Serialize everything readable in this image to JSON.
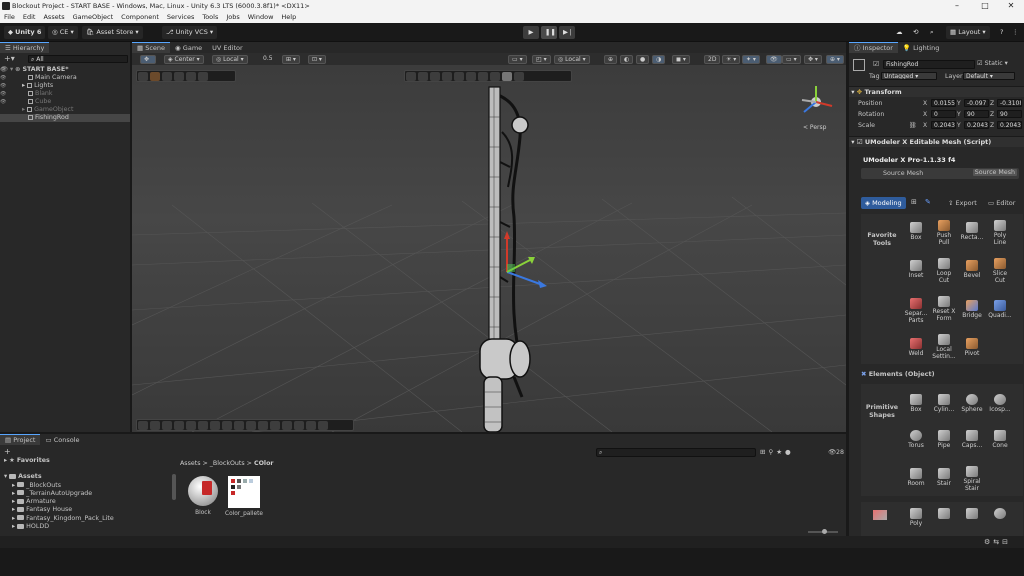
{
  "window": {
    "title": "Blockout Project - START BASE - Windows, Mac, Linux - Unity 6.3 LTS (6000.3.8f1)* <DX11>",
    "minimize": "–",
    "maximize": "□",
    "close": "✕"
  },
  "menu": [
    "File",
    "Edit",
    "Assets",
    "GameObject",
    "Component",
    "Services",
    "Tools",
    "Jobs",
    "Window",
    "Help"
  ],
  "toolbar": {
    "account": "Unity 6",
    "ce": "CE",
    "asset_store": "Asset Store",
    "vcs": "Unity VCS",
    "layout": "Layout"
  },
  "hierarchy": {
    "tab": "Hierarchy",
    "search": "All",
    "scene": "START BASE*",
    "items": [
      "Main Camera",
      "Lights",
      "Blank",
      "Cube",
      "GameObject",
      "FishingRod"
    ]
  },
  "scene_view": {
    "tabs": [
      "Scene",
      "Game",
      "UV Editor"
    ],
    "pivot": "Center",
    "space": "Local",
    "snap": "0.5",
    "handle_space": "Local",
    "persp": "< Persp"
  },
  "inspector": {
    "tabs": [
      "Inspector",
      "Lighting"
    ],
    "object_name": "FishingRod",
    "static": "Static",
    "tag_label": "Tag",
    "tag": "Untagged",
    "layer_label": "Layer",
    "layer": "Default",
    "transform": {
      "title": "Transform",
      "position": {
        "label": "Position",
        "x": "0.0155",
        "y": "-0.097",
        "z": "-0.3108"
      },
      "rotation": {
        "label": "Rotation",
        "x": "0",
        "y": "90",
        "z": "90"
      },
      "scale": {
        "label": "Scale",
        "x": "0.2043",
        "y": "0.2043",
        "z": "0.2043"
      }
    },
    "component": "UModeler X Editable Mesh (Script)",
    "umodeler_version": "UModeler X Pro-1.1.33 f4",
    "source_mesh": "Source Mesh",
    "source_mesh_btn": "Source Mesh",
    "modes": {
      "modeling": "Modeling",
      "export": "Export",
      "editor": "Editor"
    },
    "favorite_label": "Favorite Tools",
    "tools": [
      "Box",
      "Push Pull",
      "Recta...",
      "Poly Line",
      "Inset",
      "Loop Cut",
      "Bevel",
      "Slice Cut",
      "Separ... Parts",
      "Reset X Form",
      "Bridge",
      "Quadi...",
      "Weld",
      "Local Settin...",
      "Pivot"
    ],
    "elements_title": "Elements (Object)",
    "primitive_label": "Primitive Shapes",
    "primitives": [
      "Box",
      "Cylin...",
      "Sphere",
      "Icosp...",
      "Torus",
      "Pipe",
      "Caps...",
      "Cone",
      "Room",
      "Stair",
      "Spiral Stair"
    ],
    "draw_tools": [
      "Poly"
    ]
  },
  "project": {
    "tabs": [
      "Project",
      "Console"
    ],
    "favorites": "Favorites",
    "assets_root": "Assets",
    "folders": [
      "_BlockOuts",
      "_TerrainAutoUpgrade",
      "Armature",
      "Fantasy House",
      "Fantasy_Kingdom_Pack_Lite",
      "HOLDD"
    ],
    "breadcrumb": [
      "Assets",
      "_BlockOuts",
      "COlor"
    ],
    "files": [
      "Block",
      "Color_pallete"
    ],
    "count": "28"
  }
}
